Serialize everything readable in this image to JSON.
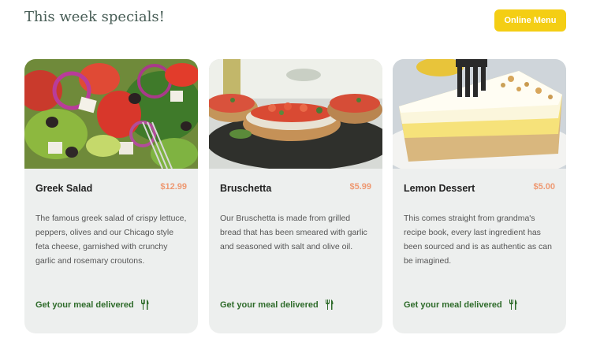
{
  "header": {
    "title": "This week specials!",
    "menu_button": "Online Menu"
  },
  "colors": {
    "accent_yellow": "#f4ce14",
    "title_green": "#495e57",
    "price_salmon": "#ee9972",
    "link_green": "#2e6b2a",
    "card_bg": "#edefee"
  },
  "specials": [
    {
      "name": "Greek Salad",
      "price": "$12.99",
      "description": "The famous greek salad of crispy lettuce, peppers, olives and our Chicago style feta cheese, garnished with crunchy garlic and rosemary croutons.",
      "link": "Get your meal delivered",
      "icon": "fork-knife-icon"
    },
    {
      "name": "Bruschetta",
      "price": "$5.99",
      "description": "Our Bruschetta is made from grilled bread that has been smeared with garlic and seasoned with salt and olive oil.",
      "link": "Get your meal delivered",
      "icon": "fork-knife-icon"
    },
    {
      "name": "Lemon Dessert",
      "price": "$5.00",
      "description": "This comes straight from grandma's recipe book, every last ingredient has been sourced and is as authentic as can be imagined.",
      "link": "Get your meal delivered",
      "icon": "fork-knife-icon"
    }
  ]
}
